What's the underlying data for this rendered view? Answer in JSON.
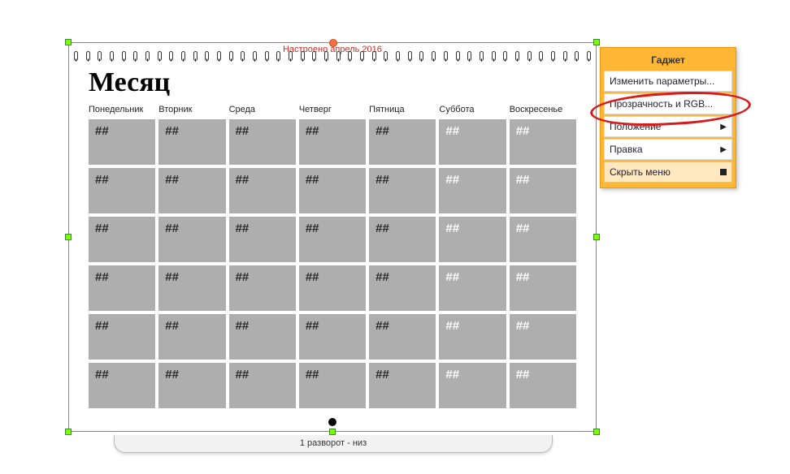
{
  "canvas": {
    "caption": "Настроено апрель 2016",
    "month_title": "Месяц",
    "day_headers": [
      "Понедельник",
      "Вторник",
      "Среда",
      "Четверг",
      "Пятница",
      "Суббота",
      "Воскресенье"
    ],
    "cell_placeholder": "##"
  },
  "bottom_tab": "1  разворот  -  низ",
  "gadget": {
    "title": "Гаджет",
    "items": [
      {
        "label": "Изменить параметры...",
        "type": "plain"
      },
      {
        "label": "Прозрачность и RGB...",
        "type": "plain"
      },
      {
        "label": "Положение",
        "type": "submenu"
      },
      {
        "label": "Правка",
        "type": "submenu"
      },
      {
        "label": "Скрыть меню",
        "type": "close"
      }
    ]
  }
}
